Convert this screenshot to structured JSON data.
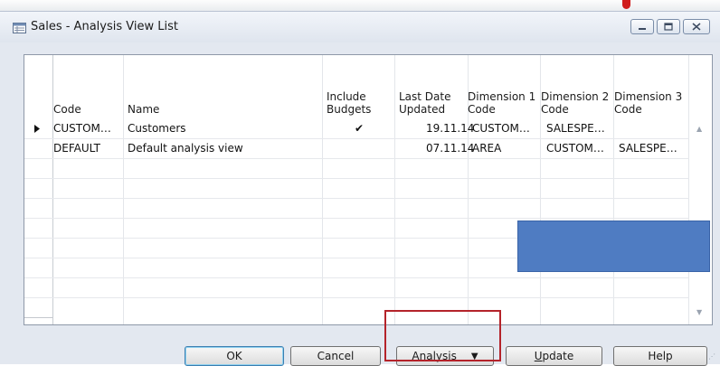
{
  "window": {
    "title": "Sales - Analysis View List"
  },
  "columns": {
    "code": "Code",
    "name": "Name",
    "include_budgets": "Include\nBudgets",
    "last_date_updated": "Last Date\nUpdated",
    "dimension_1_code": "Dimension 1\nCode",
    "dimension_2_code": "Dimension 2\nCode",
    "dimension_3_code": "Dimension 3\nCode"
  },
  "rows": [
    {
      "selected": true,
      "code": "CUSTOM…",
      "name": "Customers",
      "include_budgets": "✔",
      "last_date_updated": "19.11.14",
      "dimension_1_code": "CUSTOM…",
      "dimension_2_code": "SALESPE…",
      "dimension_3_code": ""
    },
    {
      "selected": false,
      "code": "DEFAULT",
      "name": "Default analysis view",
      "include_budgets": "",
      "last_date_updated": "07.11.14",
      "dimension_1_code": "AREA",
      "dimension_2_code": "CUSTOM…",
      "dimension_3_code": "SALESPE…"
    }
  ],
  "buttons": {
    "ok": "OK",
    "cancel": "Cancel",
    "analysis": "Analysis",
    "analysis_access_key": "A",
    "analysis_rest": "nalysis",
    "update_access_key": "U",
    "update_rest": "pdate",
    "help": "Help"
  },
  "icons": {
    "row_pointer": "row-pointer-icon",
    "dropdown": "dropdown-arrow-icon",
    "minimize": "minimize-icon",
    "maximize": "maximize-icon",
    "close": "close-icon"
  },
  "colors": {
    "window_bg": "#e3e8f0",
    "overlay_box": "#4f7cc2",
    "highlight_border": "#b4232a"
  }
}
